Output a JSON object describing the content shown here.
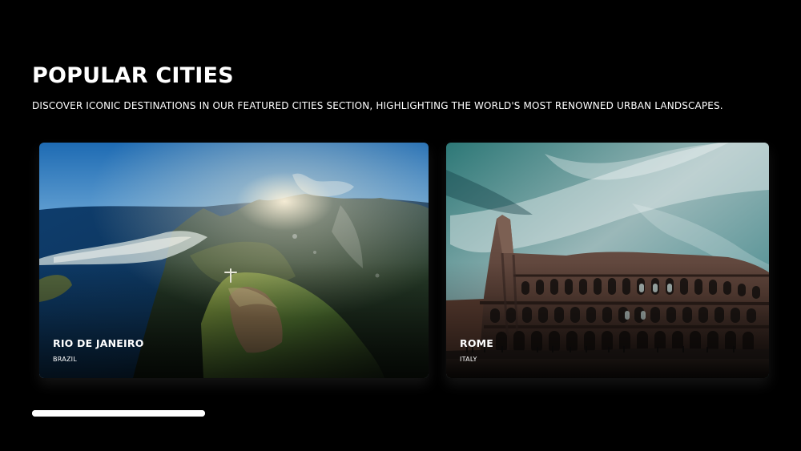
{
  "section": {
    "title": "POPULAR CITIES",
    "subtitle": "DISCOVER ICONIC DESTINATIONS IN OUR FEATURED CITIES SECTION, HIGHLIGHTING THE WORLD'S MOST RENOWNED URBAN LANDSCAPES."
  },
  "cities": [
    {
      "name": "RIO DE JANEIRO",
      "country": "BRAZIL",
      "image": "rio-de-janeiro-photo"
    },
    {
      "name": "ROME",
      "country": "ITALY",
      "image": "rome-colosseum-photo"
    }
  ],
  "carousel": {
    "scroll_progress": 1
  },
  "colors": {
    "background": "#000000",
    "text": "#ffffff",
    "progress": "#ffffff"
  }
}
